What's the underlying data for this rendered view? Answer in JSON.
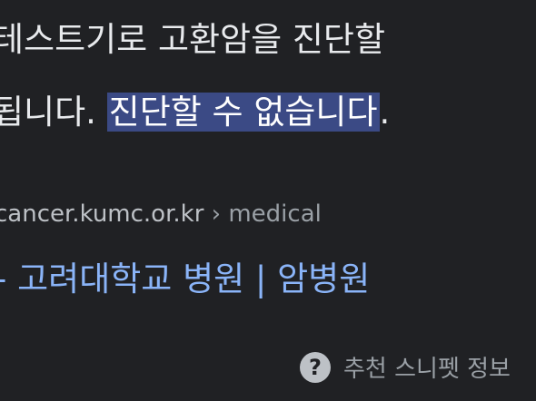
{
  "snippet": {
    "line1": "테스트기로 고환암을 진단할",
    "line2_prefix": "됩니다. ",
    "line2_highlight": "진단할 수 없습니다",
    "line2_suffix": "."
  },
  "source": {
    "domain": "cancer.kumc.or.kr",
    "separator": " › ",
    "path": "medical"
  },
  "result": {
    "title": "- 고려대학교 병원 | 암병원"
  },
  "footer": {
    "icon": "question-circle-icon",
    "icon_glyph": "?",
    "label": "추천 스니펫 정보"
  }
}
